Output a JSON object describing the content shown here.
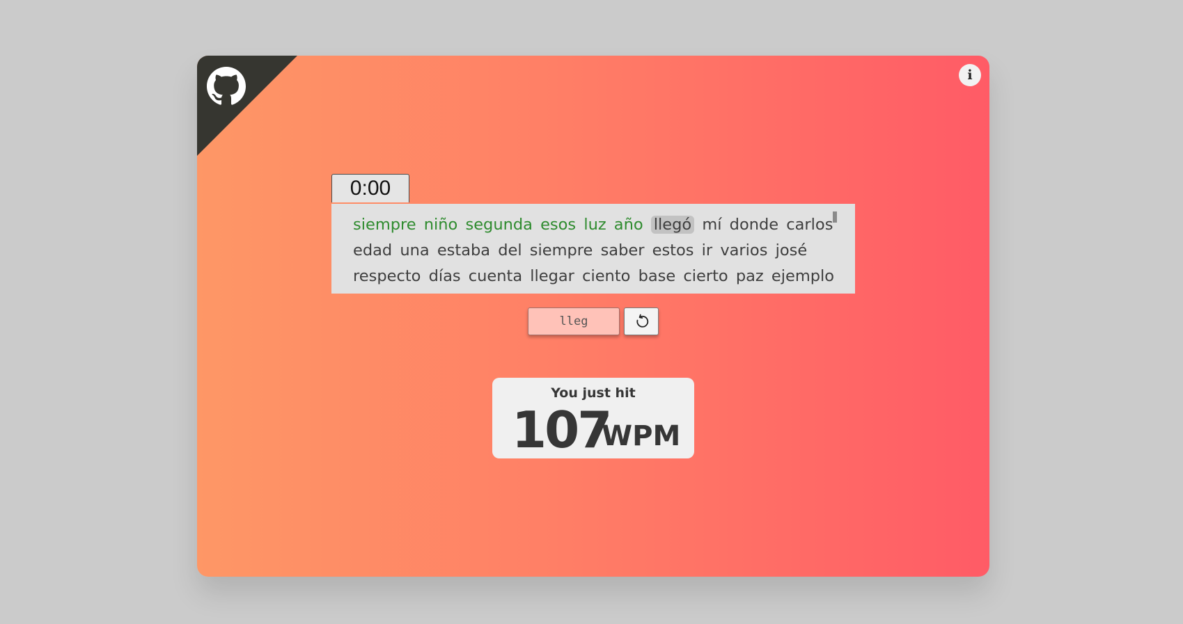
{
  "timer": {
    "value": "0:00"
  },
  "info": {
    "label": "i"
  },
  "words": {
    "items": [
      {
        "text": "siempre",
        "state": "correct"
      },
      {
        "text": "niño",
        "state": "correct"
      },
      {
        "text": "segunda",
        "state": "correct"
      },
      {
        "text": "esos",
        "state": "correct"
      },
      {
        "text": "luz",
        "state": "correct"
      },
      {
        "text": "año",
        "state": "correct"
      },
      {
        "text": "llegó",
        "state": "current"
      },
      {
        "text": "mí",
        "state": "pending"
      },
      {
        "text": "donde",
        "state": "pending"
      },
      {
        "text": "carlos",
        "state": "pending"
      },
      {
        "text": "edad",
        "state": "pending"
      },
      {
        "text": "una",
        "state": "pending"
      },
      {
        "text": "estaba",
        "state": "pending"
      },
      {
        "text": "del",
        "state": "pending"
      },
      {
        "text": "siempre",
        "state": "pending"
      },
      {
        "text": "saber",
        "state": "pending"
      },
      {
        "text": "estos",
        "state": "pending"
      },
      {
        "text": "ir",
        "state": "pending"
      },
      {
        "text": "varios",
        "state": "pending"
      },
      {
        "text": "josé",
        "state": "pending"
      },
      {
        "text": "respecto",
        "state": "pending"
      },
      {
        "text": "días",
        "state": "pending"
      },
      {
        "text": "cuenta",
        "state": "pending"
      },
      {
        "text": "llegar",
        "state": "pending"
      },
      {
        "text": "ciento",
        "state": "pending"
      },
      {
        "text": "base",
        "state": "pending"
      },
      {
        "text": "cierto",
        "state": "pending"
      },
      {
        "text": "paz",
        "state": "pending"
      },
      {
        "text": "ejemplo",
        "state": "pending"
      }
    ]
  },
  "input": {
    "value": "lleg"
  },
  "result": {
    "caption": "You just hit",
    "value": "107",
    "unit": "WPM"
  },
  "colors": {
    "gradient_start": "#fe9766",
    "gradient_end": "#ff5b66",
    "correct_word": "#2e8b2e",
    "corner": "#363630"
  },
  "icons": {
    "corner": "github-icon",
    "info": "info-icon",
    "reset": "reset-icon"
  }
}
